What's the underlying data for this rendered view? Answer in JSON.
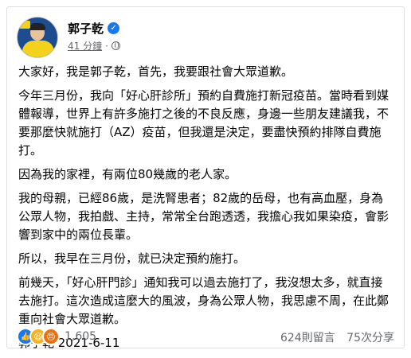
{
  "post": {
    "author": "郭子乾",
    "time": "41 分鐘",
    "paragraphs": [
      "大家好，我是郭子乾，首先，我要跟社會大眾道歉。",
      "今年三月份，我向「好心肝診所」預約自費施打新冠疫苗。當時看到媒體報導，世界上有許多施打之後的不良反應，身邊一些朋友建議我，不要那麼快就施打（AZ）疫苗，但我還是決定，要盡快預約排隊自費施打。",
      "因為我的家裡，有兩位80幾歲的老人家。",
      "我的母親，已經86歲，是洗腎患者；82歲的岳母，也有高血壓，身為公眾人物，我拍戲、主持，常常全台跑透透，我擔心我如果染疫，會影響到家中的兩位長輩。",
      "所以，我早在三月份，就已決定預約施打。",
      "前幾天，「好心肝門診」通知我可以過去施打了，我沒想太多，就直接去施打。這次造成這麼大的風波，身為公眾人物，我思慮不周，在此鄭重向社會大眾道歉。",
      "郭子乾 2021-6-11"
    ]
  },
  "footer": {
    "reaction_count": "1,605",
    "comments": "624則留言",
    "shares": "75次分享"
  },
  "icons": {
    "verified": "verified-badge-icon",
    "globe": "globe-icon",
    "like": "like-reaction-icon",
    "laugh": "haha-reaction-icon",
    "angry": "angry-reaction-icon"
  },
  "colors": {
    "accent": "#1877f2",
    "meta_text": "#65676b"
  }
}
